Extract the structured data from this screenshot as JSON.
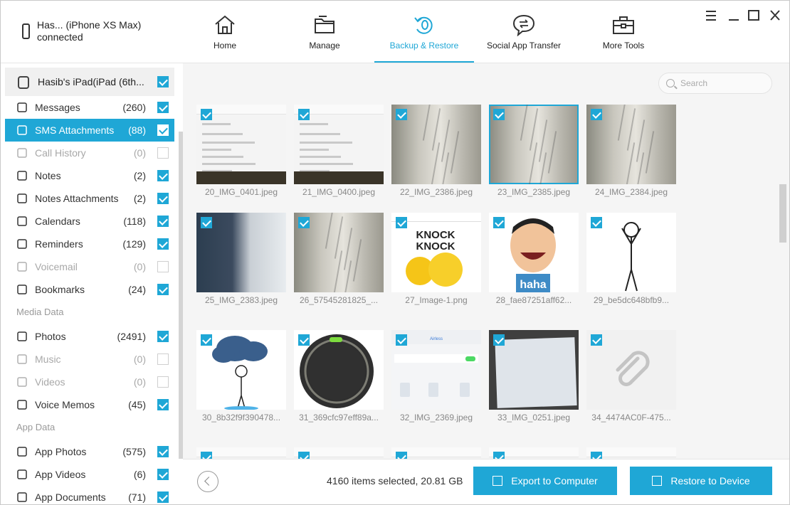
{
  "device": {
    "name": "Has... (iPhone XS Max)",
    "status": "connected"
  },
  "nav": [
    {
      "label": "Home",
      "icon": "home-icon"
    },
    {
      "label": "Manage",
      "icon": "folder-icon"
    },
    {
      "label": "Backup & Restore",
      "icon": "backup-restore-icon",
      "active": true
    },
    {
      "label": "Social App Transfer",
      "icon": "chat-transfer-icon"
    },
    {
      "label": "More Tools",
      "icon": "toolbox-icon"
    }
  ],
  "sidebar": {
    "backup_device": {
      "label": "Hasib's iPad(iPad (6th...",
      "checked": true
    },
    "items": [
      {
        "label": "Messages",
        "count": "(260)",
        "checked": true,
        "icon": "message-icon"
      },
      {
        "label": "SMS Attachments",
        "count": "(88)",
        "checked": true,
        "selected": true,
        "icon": "sms-attachment-icon"
      },
      {
        "label": "Call History",
        "count": "(0)",
        "checked": false,
        "dim": true,
        "icon": "phone-icon"
      },
      {
        "label": "Notes",
        "count": "(2)",
        "checked": true,
        "icon": "note-icon"
      },
      {
        "label": "Notes Attachments",
        "count": "(2)",
        "checked": true,
        "icon": "note-attachment-icon"
      },
      {
        "label": "Calendars",
        "count": "(118)",
        "checked": true,
        "icon": "calendar-icon"
      },
      {
        "label": "Reminders",
        "count": "(129)",
        "checked": true,
        "icon": "reminder-icon"
      },
      {
        "label": "Voicemail",
        "count": "(0)",
        "checked": false,
        "dim": true,
        "icon": "voicemail-icon"
      },
      {
        "label": "Bookmarks",
        "count": "(24)",
        "checked": true,
        "icon": "bookmark-icon"
      }
    ],
    "media_section": "Media Data",
    "media": [
      {
        "label": "Photos",
        "count": "(2491)",
        "checked": true,
        "icon": "photo-icon"
      },
      {
        "label": "Music",
        "count": "(0)",
        "checked": false,
        "dim": true,
        "icon": "music-icon"
      },
      {
        "label": "Videos",
        "count": "(0)",
        "checked": false,
        "dim": true,
        "icon": "video-icon"
      },
      {
        "label": "Voice Memos",
        "count": "(45)",
        "checked": true,
        "icon": "microphone-icon"
      }
    ],
    "app_section": "App Data",
    "app": [
      {
        "label": "App Photos",
        "count": "(575)",
        "checked": true,
        "icon": "app-photo-icon"
      },
      {
        "label": "App Videos",
        "count": "(6)",
        "checked": true,
        "icon": "app-video-icon"
      },
      {
        "label": "App Documents",
        "count": "(71)",
        "checked": true,
        "icon": "app-document-icon"
      }
    ]
  },
  "search": {
    "placeholder": "Search"
  },
  "grid": [
    {
      "name": "20_IMG_0401.jpeg",
      "kind": "phone"
    },
    {
      "name": "21_IMG_0400.jpeg",
      "kind": "phone"
    },
    {
      "name": "22_IMG_2386.jpeg",
      "kind": "paper"
    },
    {
      "name": "23_IMG_2385.jpeg",
      "kind": "paper",
      "highlight": true
    },
    {
      "name": "24_IMG_2384.jpeg",
      "kind": "paper"
    },
    {
      "name": "25_IMG_2383.jpeg",
      "kind": "dark"
    },
    {
      "name": "26_57545281825_...",
      "kind": "paper"
    },
    {
      "name": "27_Image-1.png",
      "kind": "knock",
      "text": "KNOCK KNOCK"
    },
    {
      "name": "28_fae87251aff62...",
      "kind": "haha",
      "text": "haha"
    },
    {
      "name": "29_be5dc648bfb9...",
      "kind": "stick"
    },
    {
      "name": "30_8b32f9f390478...",
      "kind": "cloud"
    },
    {
      "name": "31_369cfc97eff89a...",
      "kind": "ring"
    },
    {
      "name": "32_IMG_2369.jpeg",
      "kind": "settings",
      "text": "Airless"
    },
    {
      "name": "33_IMG_0251.jpeg",
      "kind": "screen"
    },
    {
      "name": "34_4474AC0F-475...",
      "kind": "clip"
    }
  ],
  "footer": {
    "status": "4160 items selected, 20.81 GB",
    "export_label": "Export to Computer",
    "restore_label": "Restore to Device"
  },
  "colors": {
    "accent": "#1fa7d6"
  }
}
